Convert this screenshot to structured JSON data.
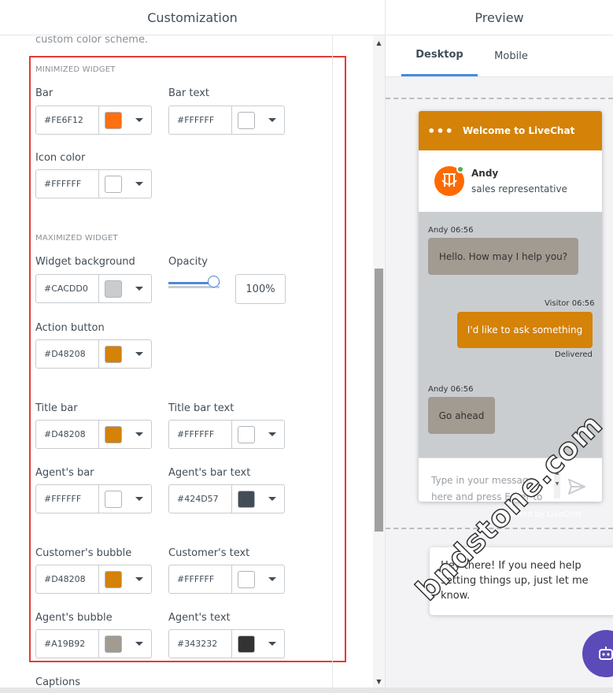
{
  "customization": {
    "title": "Customization",
    "cut_text": "custom color scheme.",
    "minimized_title": "MINIMIZED WIDGET",
    "maximized_title": "MAXIMIZED WIDGET",
    "fields": {
      "bar": {
        "label": "Bar",
        "hex": "#FE6F12",
        "color": "#FE6F12"
      },
      "bar_text": {
        "label": "Bar text",
        "hex": "#FFFFFF",
        "color": "#FFFFFF"
      },
      "icon_color": {
        "label": "Icon color",
        "hex": "#FFFFFF",
        "color": "#FFFFFF"
      },
      "widget_bg": {
        "label": "Widget background",
        "hex": "#CACDD0",
        "color": "#CACDD0"
      },
      "action_button": {
        "label": "Action button",
        "hex": "#D48208",
        "color": "#D48208"
      },
      "title_bar": {
        "label": "Title bar",
        "hex": "#D48208",
        "color": "#D48208"
      },
      "title_bar_text": {
        "label": "Title bar text",
        "hex": "#FFFFFF",
        "color": "#FFFFFF"
      },
      "agents_bar": {
        "label": "Agent's bar",
        "hex": "#FFFFFF",
        "color": "#FFFFFF"
      },
      "agents_bar_text": {
        "label": "Agent's bar text",
        "hex": "#424D57",
        "color": "#424D57"
      },
      "customers_bubble": {
        "label": "Customer's bubble",
        "hex": "#D48208",
        "color": "#D48208"
      },
      "customers_text": {
        "label": "Customer's text",
        "hex": "#FFFFFF",
        "color": "#FFFFFF"
      },
      "agents_bubble": {
        "label": "Agent's bubble",
        "hex": "#A19B92",
        "color": "#A19B92"
      },
      "agents_text": {
        "label": "Agent's text",
        "hex": "#343232",
        "color": "#343232"
      }
    },
    "opacity": {
      "label": "Opacity",
      "value": "100%",
      "level": 1.0
    },
    "captions_label": "Captions"
  },
  "preview": {
    "title": "Preview",
    "tabs": [
      {
        "label": "Desktop",
        "active": true
      },
      {
        "label": "Mobile",
        "active": false
      }
    ],
    "widget": {
      "title": "Welcome to LiveChat",
      "agent_name": "Andy",
      "agent_role": "sales representative",
      "messages": [
        {
          "meta": "Andy 06:56",
          "text": "Hello. How may I help you?"
        },
        {
          "meta": "Visitor 06:56",
          "text": "I'd like to ask something",
          "status": "Delivered"
        },
        {
          "meta": "Andy 06:56",
          "text": "Go ahead"
        }
      ],
      "input_placeholder": "Type in your message here and press Enter to",
      "powered_by": "Powered by LiveChat"
    },
    "greeting": "Hey there! If you need help setting things up, just let me know.",
    "watermark": "bndstone.com"
  }
}
